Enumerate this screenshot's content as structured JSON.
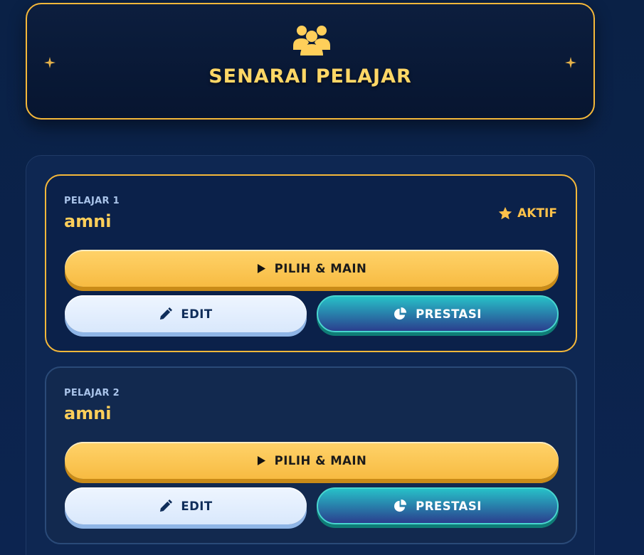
{
  "header": {
    "title": "SENARAI PELAJAR",
    "icon": "users-icon",
    "accent": "#f5b83a"
  },
  "students": [
    {
      "label": "PELAJAR 1",
      "name": "amni",
      "status": "AKTIF",
      "play_label": "PILIH & MAIN",
      "edit_label": "EDIT",
      "performance_label": "PRESTASI"
    },
    {
      "label": "PELAJAR 2",
      "name": "amni",
      "play_label": "PILIH & MAIN",
      "edit_label": "EDIT",
      "performance_label": "PRESTASI"
    }
  ],
  "colors": {
    "background": "#0b2249",
    "gold": "#ffcf5a",
    "teal": "#27c0c8"
  }
}
